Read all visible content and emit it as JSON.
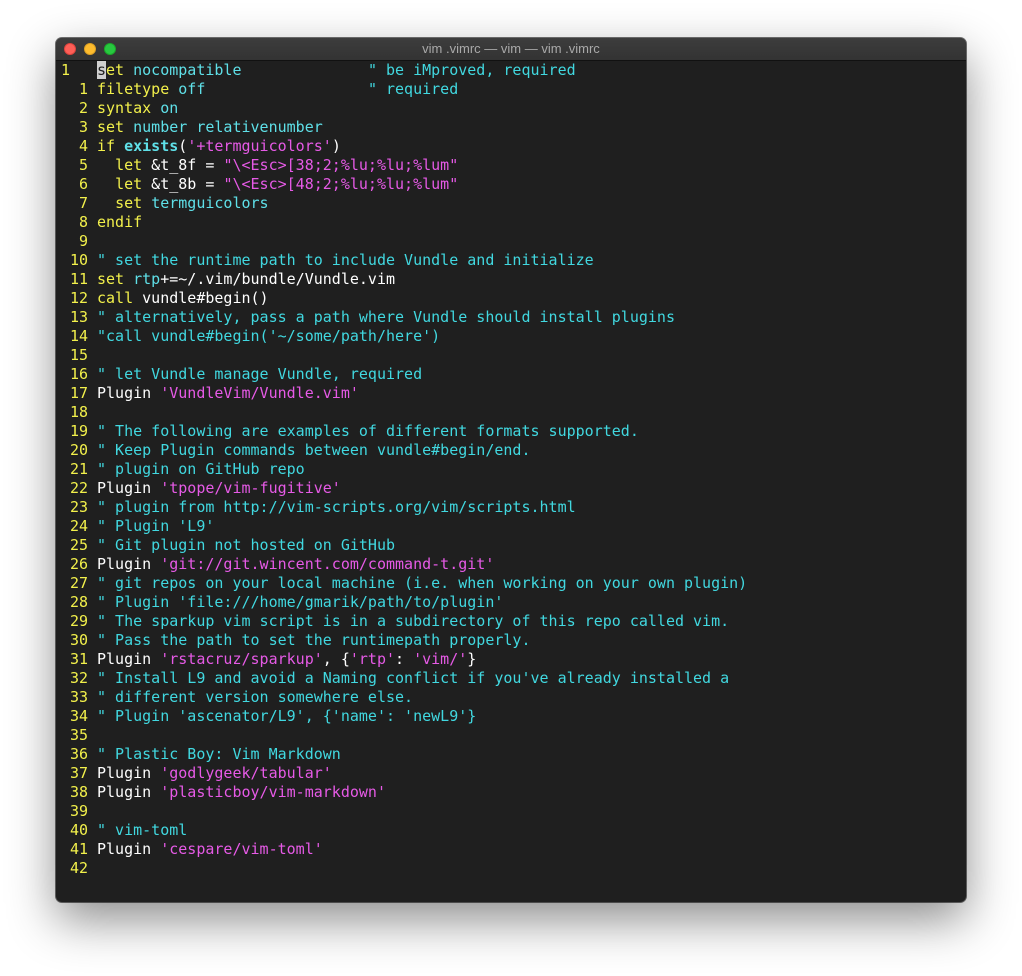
{
  "window": {
    "title": "vim .vimrc — vim — vim .vimrc"
  },
  "editor": {
    "lines": [
      {
        "num": "1",
        "current": true,
        "tokens": [
          {
            "c": "cursor",
            "t": "s"
          },
          {
            "c": "kw",
            "t": "et"
          },
          {
            "c": "op",
            "t": " "
          },
          {
            "c": "fn",
            "t": "nocompatible"
          },
          {
            "c": "op",
            "t": "              "
          },
          {
            "c": "cm",
            "t": "\" be iMproved, required"
          }
        ]
      },
      {
        "num": "1",
        "tokens": [
          {
            "c": "kw",
            "t": "filetype"
          },
          {
            "c": "op",
            "t": " "
          },
          {
            "c": "fn",
            "t": "off"
          },
          {
            "c": "op",
            "t": "                  "
          },
          {
            "c": "cm",
            "t": "\" required"
          }
        ]
      },
      {
        "num": "2",
        "tokens": [
          {
            "c": "kw",
            "t": "syntax"
          },
          {
            "c": "op",
            "t": " "
          },
          {
            "c": "fn",
            "t": "on"
          }
        ]
      },
      {
        "num": "3",
        "tokens": [
          {
            "c": "kw",
            "t": "set"
          },
          {
            "c": "op",
            "t": " "
          },
          {
            "c": "fn",
            "t": "number relativenumber"
          }
        ]
      },
      {
        "num": "4",
        "tokens": [
          {
            "c": "kw",
            "t": "if"
          },
          {
            "c": "op",
            "t": " "
          },
          {
            "c": "kwb",
            "t": "exists"
          },
          {
            "c": "op",
            "t": "("
          },
          {
            "c": "st",
            "t": "'+termguicolors'"
          },
          {
            "c": "op",
            "t": ")"
          }
        ]
      },
      {
        "num": "5",
        "tokens": [
          {
            "c": "op",
            "t": "  "
          },
          {
            "c": "kw",
            "t": "let"
          },
          {
            "c": "op",
            "t": " &t_8f = "
          },
          {
            "c": "st",
            "t": "\"\\<Esc>[38;2;%lu;%lu;%lum\""
          }
        ]
      },
      {
        "num": "6",
        "tokens": [
          {
            "c": "op",
            "t": "  "
          },
          {
            "c": "kw",
            "t": "let"
          },
          {
            "c": "op",
            "t": " &t_8b = "
          },
          {
            "c": "st",
            "t": "\"\\<Esc>[48;2;%lu;%lu;%lum\""
          }
        ]
      },
      {
        "num": "7",
        "tokens": [
          {
            "c": "op",
            "t": "  "
          },
          {
            "c": "kw",
            "t": "set"
          },
          {
            "c": "op",
            "t": " "
          },
          {
            "c": "fn",
            "t": "termguicolors"
          }
        ]
      },
      {
        "num": "8",
        "tokens": [
          {
            "c": "kw",
            "t": "endif"
          }
        ]
      },
      {
        "num": "9",
        "tokens": []
      },
      {
        "num": "10",
        "tokens": [
          {
            "c": "cm",
            "t": "\" set the runtime path to include Vundle and initialize"
          }
        ]
      },
      {
        "num": "11",
        "tokens": [
          {
            "c": "kw",
            "t": "set"
          },
          {
            "c": "op",
            "t": " "
          },
          {
            "c": "fn",
            "t": "rtp"
          },
          {
            "c": "op",
            "t": "+=~/.vim/bundle/Vundle.vim"
          }
        ]
      },
      {
        "num": "12",
        "tokens": [
          {
            "c": "kw",
            "t": "call"
          },
          {
            "c": "op",
            "t": " vundle#begin()"
          }
        ]
      },
      {
        "num": "13",
        "tokens": [
          {
            "c": "cm",
            "t": "\" alternatively, pass a path where Vundle should install plugins"
          }
        ]
      },
      {
        "num": "14",
        "tokens": [
          {
            "c": "cm",
            "t": "\"call vundle#begin('~/some/path/here')"
          }
        ]
      },
      {
        "num": "15",
        "tokens": []
      },
      {
        "num": "16",
        "tokens": [
          {
            "c": "cm",
            "t": "\" let Vundle manage Vundle, required"
          }
        ]
      },
      {
        "num": "17",
        "tokens": [
          {
            "c": "op",
            "t": "Plugin "
          },
          {
            "c": "st",
            "t": "'VundleVim/Vundle.vim'"
          }
        ]
      },
      {
        "num": "18",
        "tokens": []
      },
      {
        "num": "19",
        "tokens": [
          {
            "c": "cm",
            "t": "\" The following are examples of different formats supported."
          }
        ]
      },
      {
        "num": "20",
        "tokens": [
          {
            "c": "cm",
            "t": "\" Keep Plugin commands between vundle#begin/end."
          }
        ]
      },
      {
        "num": "21",
        "tokens": [
          {
            "c": "cm",
            "t": "\" plugin on GitHub repo"
          }
        ]
      },
      {
        "num": "22",
        "tokens": [
          {
            "c": "op",
            "t": "Plugin "
          },
          {
            "c": "st",
            "t": "'tpope/vim-fugitive'"
          }
        ]
      },
      {
        "num": "23",
        "tokens": [
          {
            "c": "cm",
            "t": "\" plugin from http://vim-scripts.org/vim/scripts.html"
          }
        ]
      },
      {
        "num": "24",
        "tokens": [
          {
            "c": "cm",
            "t": "\" Plugin 'L9'"
          }
        ]
      },
      {
        "num": "25",
        "tokens": [
          {
            "c": "cm",
            "t": "\" Git plugin not hosted on GitHub"
          }
        ]
      },
      {
        "num": "26",
        "tokens": [
          {
            "c": "op",
            "t": "Plugin "
          },
          {
            "c": "st",
            "t": "'git://git.wincent.com/command-t.git'"
          }
        ]
      },
      {
        "num": "27",
        "tokens": [
          {
            "c": "cm",
            "t": "\" git repos on your local machine (i.e. when working on your own plugin)"
          }
        ]
      },
      {
        "num": "28",
        "tokens": [
          {
            "c": "cm",
            "t": "\" Plugin 'file:///home/gmarik/path/to/plugin'"
          }
        ]
      },
      {
        "num": "29",
        "tokens": [
          {
            "c": "cm",
            "t": "\" The sparkup vim script is in a subdirectory of this repo called vim."
          }
        ]
      },
      {
        "num": "30",
        "tokens": [
          {
            "c": "cm",
            "t": "\" Pass the path to set the runtimepath properly."
          }
        ]
      },
      {
        "num": "31",
        "tokens": [
          {
            "c": "op",
            "t": "Plugin "
          },
          {
            "c": "st",
            "t": "'rstacruz/sparkup'"
          },
          {
            "c": "op",
            "t": ", {"
          },
          {
            "c": "st",
            "t": "'rtp'"
          },
          {
            "c": "op",
            "t": ": "
          },
          {
            "c": "st",
            "t": "'vim/'"
          },
          {
            "c": "op",
            "t": "}"
          }
        ]
      },
      {
        "num": "32",
        "tokens": [
          {
            "c": "cm",
            "t": "\" Install L9 and avoid a Naming conflict if you've already installed a"
          }
        ]
      },
      {
        "num": "33",
        "tokens": [
          {
            "c": "cm",
            "t": "\" different version somewhere else."
          }
        ]
      },
      {
        "num": "34",
        "tokens": [
          {
            "c": "cm",
            "t": "\" Plugin 'ascenator/L9', {'name': 'newL9'}"
          }
        ]
      },
      {
        "num": "35",
        "tokens": []
      },
      {
        "num": "36",
        "tokens": [
          {
            "c": "cm",
            "t": "\" Plastic Boy: Vim Markdown"
          }
        ]
      },
      {
        "num": "37",
        "tokens": [
          {
            "c": "op",
            "t": "Plugin "
          },
          {
            "c": "st",
            "t": "'godlygeek/tabular'"
          }
        ]
      },
      {
        "num": "38",
        "tokens": [
          {
            "c": "op",
            "t": "Plugin "
          },
          {
            "c": "st",
            "t": "'plasticboy/vim-markdown'"
          }
        ]
      },
      {
        "num": "39",
        "tokens": []
      },
      {
        "num": "40",
        "tokens": [
          {
            "c": "cm",
            "t": "\" vim-toml"
          }
        ]
      },
      {
        "num": "41",
        "tokens": [
          {
            "c": "op",
            "t": "Plugin "
          },
          {
            "c": "st",
            "t": "'cespare/vim-toml'"
          }
        ]
      },
      {
        "num": "42",
        "tokens": []
      }
    ]
  }
}
